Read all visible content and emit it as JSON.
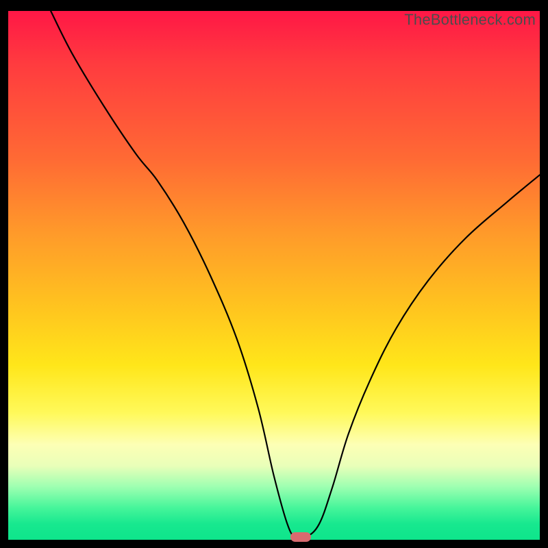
{
  "watermark": "TheBottleneck.com",
  "chart_data": {
    "type": "line",
    "title": "",
    "xlabel": "",
    "ylabel": "",
    "xlim": [
      0,
      100
    ],
    "ylim": [
      0,
      100
    ],
    "series": [
      {
        "name": "bottleneck-curve",
        "x": [
          8,
          12,
          18,
          24,
          28,
          33,
          38,
          43,
          47,
          50,
          52.5,
          54,
          56,
          58.5,
          61,
          64,
          68,
          73,
          79,
          86,
          94,
          100
        ],
        "y": [
          100,
          92,
          82,
          73,
          68,
          60,
          50,
          38,
          25,
          12,
          3,
          0.5,
          0.5,
          3,
          10,
          20,
          30,
          40,
          49,
          57,
          64,
          69
        ]
      }
    ],
    "marker": {
      "x": 55,
      "y": 0.5
    },
    "gradient_stops": [
      {
        "pos": 0,
        "color": "#ff1746"
      },
      {
        "pos": 10,
        "color": "#ff3b3f"
      },
      {
        "pos": 28,
        "color": "#ff6a34"
      },
      {
        "pos": 42,
        "color": "#ff9a2a"
      },
      {
        "pos": 56,
        "color": "#ffc41f"
      },
      {
        "pos": 67,
        "color": "#ffe61a"
      },
      {
        "pos": 76,
        "color": "#fff95a"
      },
      {
        "pos": 82,
        "color": "#fdffb5"
      },
      {
        "pos": 86,
        "color": "#e9ffb9"
      },
      {
        "pos": 90,
        "color": "#9dffb1"
      },
      {
        "pos": 94,
        "color": "#45f59a"
      },
      {
        "pos": 97,
        "color": "#17e88f"
      },
      {
        "pos": 100,
        "color": "#0ee58b"
      }
    ]
  }
}
